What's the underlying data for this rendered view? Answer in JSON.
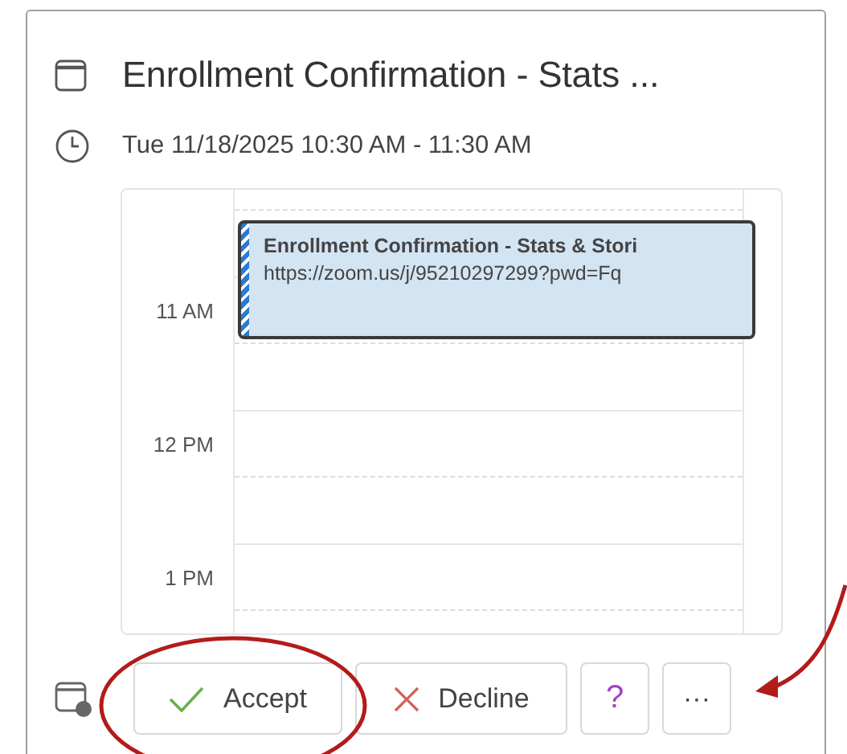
{
  "title": "Enrollment Confirmation - Stats ...",
  "time": "Tue 11/18/2025 10:30 AM - 11:30 AM",
  "calendar": {
    "hours": [
      "11 AM",
      "12 PM",
      "1 PM"
    ],
    "event": {
      "title": "Enrollment Confirmation - Stats & Stori",
      "link": "https://zoom.us/j/95210297299?pwd=Fq"
    }
  },
  "actions": [
    {
      "kind": "accept",
      "label": "Accept"
    },
    {
      "kind": "decline",
      "label": "Decline"
    },
    {
      "kind": "tentative",
      "label": "?"
    },
    {
      "kind": "more",
      "label": "···"
    }
  ]
}
